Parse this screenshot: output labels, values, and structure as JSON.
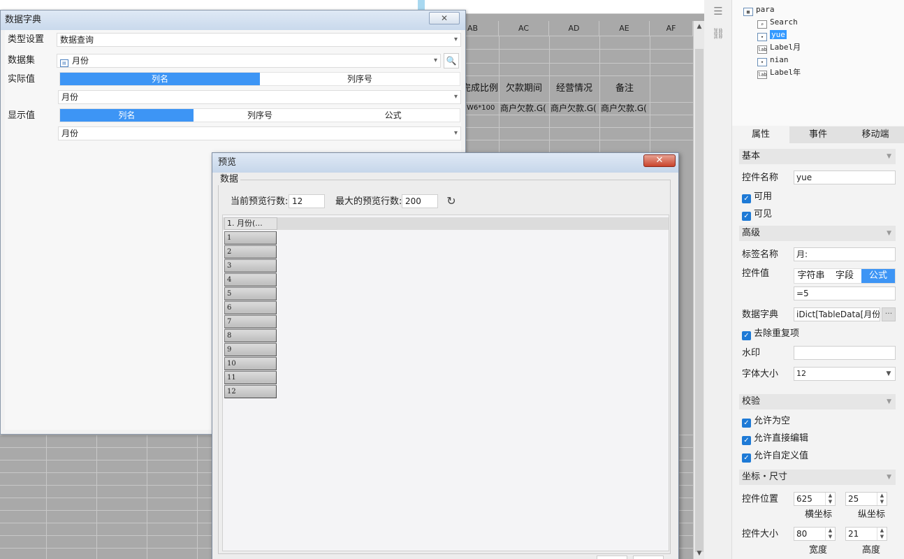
{
  "sheet": {
    "columns": [
      "AB",
      "AC",
      "AD",
      "AE",
      "AF"
    ],
    "header_cells": [
      "完成比例",
      "欠款期间",
      "经营情况",
      "备注"
    ],
    "row_cells": [
      "W6*100",
      "商户欠款.G(",
      "商户欠款.G(",
      "商户欠款.G("
    ]
  },
  "toolbar_icons": [
    "widget-list-icon",
    "link-icon"
  ],
  "tree": {
    "root": "para",
    "children": [
      {
        "label": "Search",
        "icon": "search-widget-icon",
        "selected": false
      },
      {
        "label": "yue",
        "icon": "combo-widget-icon",
        "selected": true
      },
      {
        "label": "Label月",
        "icon": "label-widget-icon",
        "selected": false
      },
      {
        "label": "nian",
        "icon": "combo-widget-icon",
        "selected": false
      },
      {
        "label": "Label年",
        "icon": "label-widget-icon",
        "selected": false
      }
    ]
  },
  "props": {
    "tabs": [
      "属性",
      "事件",
      "移动端"
    ],
    "active_tab": "属性",
    "basic": {
      "section": "基本",
      "name_label": "控件名称",
      "name_value": "yue",
      "enabled_label": "可用",
      "visible_label": "可见"
    },
    "advanced": {
      "section": "高级",
      "tag_label": "标签名称",
      "tag_value": "月:",
      "value_label": "控件值",
      "value_modes": [
        "字符串",
        "字段",
        "公式"
      ],
      "value_mode_selected": "公式",
      "value_formula": "=5",
      "dict_label": "数据字典",
      "dict_value": "iDict[TableData[月份]]",
      "dict_button": "···",
      "dedupe_label": "去除重复项",
      "watermark_label": "水印",
      "watermark_value": "",
      "fontsize_label": "字体大小",
      "fontsize_value": "12"
    },
    "validate": {
      "section": "校验",
      "allow_empty": "允许为空",
      "allow_edit": "允许直接编辑",
      "allow_custom": "允许自定义值"
    },
    "geometry": {
      "section": "坐标・尺寸",
      "pos_label": "控件位置",
      "x_value": "625",
      "y_value": "25",
      "x_caption": "横坐标",
      "y_caption": "纵坐标",
      "size_label": "控件大小",
      "w_value": "80",
      "h_value": "21",
      "w_caption": "宽度",
      "h_caption": "高度"
    }
  },
  "dict_dialog": {
    "title": "数据字典",
    "close": "✕",
    "type_label": "类型设置",
    "type_value": "数据查询",
    "dataset_label": "数据集",
    "dataset_value": "月份",
    "actual_label": "实际值",
    "actual_tabs": [
      "列名",
      "列序号"
    ],
    "actual_value": "月份",
    "display_label": "显示值",
    "display_tabs": [
      "列名",
      "列序号",
      "公式"
    ],
    "display_value": "月份"
  },
  "preview_dialog": {
    "title": "预览",
    "close": "✕",
    "group": "数据",
    "current_rows_label": "当前预览行数:",
    "current_rows_value": "12",
    "max_rows_label": "最大的预览行数:",
    "max_rows_value": "200",
    "column_header": "1. 月份(...",
    "rows": [
      "1",
      "2",
      "3",
      "4",
      "5",
      "6",
      "7",
      "8",
      "9",
      "10",
      "11",
      "12"
    ]
  },
  "colors": {
    "accent": "#3d95f5",
    "checkbox": "#1e7ad6",
    "close_red": "#c9432b",
    "sheet_gray": "#a9a9a9"
  }
}
